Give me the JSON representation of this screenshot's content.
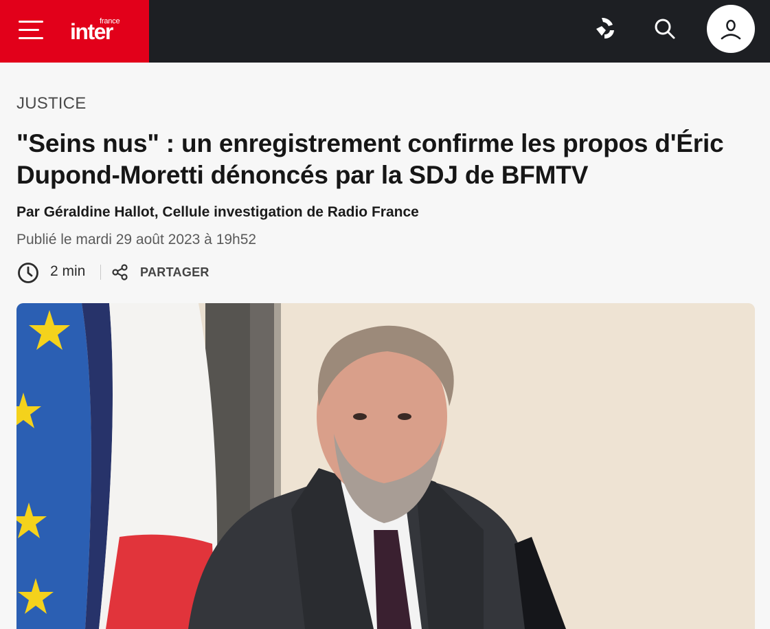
{
  "header": {
    "logo_small": "france",
    "logo_main": "inter",
    "colors": {
      "brand": "#e2001a",
      "bar": "#1d1f23"
    },
    "icons": [
      "menu-icon",
      "radio-live-icon",
      "search-icon",
      "user-icon"
    ]
  },
  "article": {
    "category": "JUSTICE",
    "headline": "\"Seins nus\" : un enregistrement confirme les propos d'Éric Dupond-Moretti dénoncés par la SDJ de BFMTV",
    "byline": "Par Géraldine Hallot, Cellule investigation de Radio France",
    "published": "Publié le mardi 29 août 2023 à 19h52",
    "read_time": "2 min",
    "share_label": "PARTAGER"
  }
}
